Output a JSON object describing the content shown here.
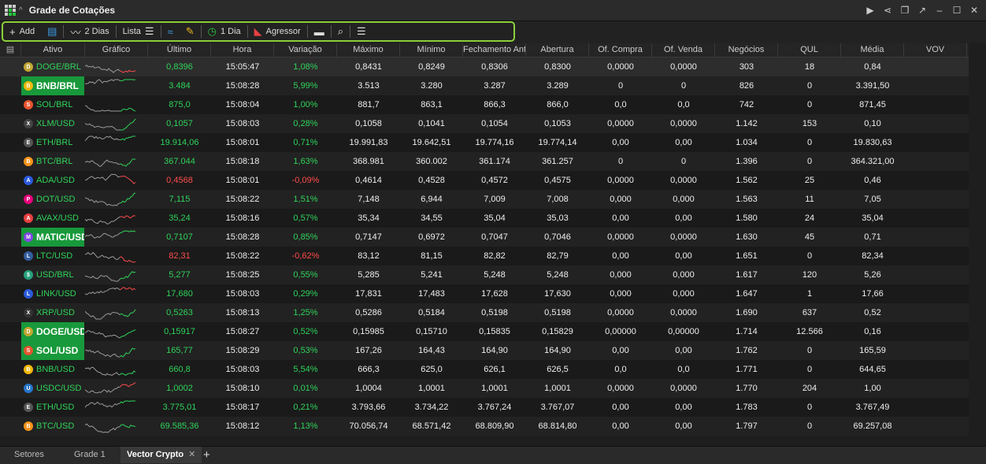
{
  "window": {
    "title": "Grade de Cotações"
  },
  "toolbar": {
    "add": "Add",
    "period": "2 Dias",
    "lista": "Lista",
    "interval": "1 Dia",
    "agressor": "Agressor"
  },
  "columns": [
    "Ativo",
    "Gráfico",
    "Último",
    "Hora",
    "Variação",
    "Máximo",
    "Mínimo",
    "Fechamento Ant",
    "Abertura",
    "Of. Compra",
    "Of. Venda",
    "Negócios",
    "QUL",
    "Média",
    "VOV"
  ],
  "rows": [
    {
      "ativo": "DOGE/BRL",
      "coin": "D",
      "coin_color": "#c2a633",
      "highlight": false,
      "trend": "mixed",
      "ultimo": "0,8396",
      "hora": "15:05:47",
      "variacao": "1,08%",
      "var_sign": "up",
      "maximo": "0,8431",
      "minimo": "0,8249",
      "fechamento": "0,8306",
      "abertura": "0,8300",
      "of_compra": "0,0000",
      "of_venda": "0,0000",
      "negocios": "303",
      "qul": "18",
      "media": "0,84",
      "vov": ""
    },
    {
      "ativo": "BNB/BRL",
      "coin": "B",
      "coin_color": "#f0b90b",
      "highlight": true,
      "trend": "up",
      "ultimo": "3.484",
      "hora": "15:08:28",
      "variacao": "5,99%",
      "var_sign": "up",
      "maximo": "3.513",
      "minimo": "3.280",
      "fechamento": "3.287",
      "abertura": "3.289",
      "of_compra": "0",
      "of_venda": "0",
      "negocios": "826",
      "qul": "0",
      "media": "3.391,50",
      "vov": ""
    },
    {
      "ativo": "SOL/BRL",
      "coin": "S",
      "coin_color": "#e8542f",
      "highlight": false,
      "trend": "up",
      "ultimo": "875,0",
      "hora": "15:08:04",
      "variacao": "1,00%",
      "var_sign": "up",
      "maximo": "881,7",
      "minimo": "863,1",
      "fechamento": "866,3",
      "abertura": "866,0",
      "of_compra": "0,0",
      "of_venda": "0,0",
      "negocios": "742",
      "qul": "0",
      "media": "871,45",
      "vov": ""
    },
    {
      "ativo": "XLM/USD",
      "coin": "X",
      "coin_color": "#444444",
      "highlight": false,
      "trend": "up",
      "ultimo": "0,1057",
      "hora": "15:08:03",
      "variacao": "0,28%",
      "var_sign": "up",
      "maximo": "0,1058",
      "minimo": "0,1041",
      "fechamento": "0,1054",
      "abertura": "0,1053",
      "of_compra": "0,0000",
      "of_venda": "0,0000",
      "negocios": "1.142",
      "qul": "153",
      "media": "0,10",
      "vov": ""
    },
    {
      "ativo": "ETH/BRL",
      "coin": "E",
      "coin_color": "#555555",
      "highlight": false,
      "trend": "up",
      "ultimo": "19.914,06",
      "hora": "15:08:01",
      "variacao": "0,71%",
      "var_sign": "up",
      "maximo": "19.991,83",
      "minimo": "19.642,51",
      "fechamento": "19.774,16",
      "abertura": "19.774,14",
      "of_compra": "0,00",
      "of_venda": "0,00",
      "negocios": "1.034",
      "qul": "0",
      "media": "19.830,63",
      "vov": ""
    },
    {
      "ativo": "BTC/BRL",
      "coin": "B",
      "coin_color": "#f7931a",
      "highlight": false,
      "trend": "up",
      "ultimo": "367.044",
      "hora": "15:08:18",
      "variacao": "1,63%",
      "var_sign": "up",
      "maximo": "368.981",
      "minimo": "360.002",
      "fechamento": "361.174",
      "abertura": "361.257",
      "of_compra": "0",
      "of_venda": "0",
      "negocios": "1.396",
      "qul": "0",
      "media": "364.321,00",
      "vov": ""
    },
    {
      "ativo": "ADA/USD",
      "coin": "A",
      "coin_color": "#2a5ada",
      "highlight": false,
      "trend": "down",
      "ultimo": "0,4568",
      "hora": "15:08:01",
      "variacao": "-0,09%",
      "var_sign": "down",
      "maximo": "0,4614",
      "minimo": "0,4528",
      "fechamento": "0,4572",
      "abertura": "0,4575",
      "of_compra": "0,0000",
      "of_venda": "0,0000",
      "negocios": "1.562",
      "qul": "25",
      "media": "0,46",
      "vov": ""
    },
    {
      "ativo": "DOT/USD",
      "coin": "P",
      "coin_color": "#e6007a",
      "highlight": false,
      "trend": "up",
      "ultimo": "7,115",
      "hora": "15:08:22",
      "variacao": "1,51%",
      "var_sign": "up",
      "maximo": "7,148",
      "minimo": "6,944",
      "fechamento": "7,009",
      "abertura": "7,008",
      "of_compra": "0,000",
      "of_venda": "0,000",
      "negocios": "1.563",
      "qul": "11",
      "media": "7,05",
      "vov": ""
    },
    {
      "ativo": "AVAX/USD",
      "coin": "A",
      "coin_color": "#e84142",
      "highlight": false,
      "trend": "mixed",
      "ultimo": "35,24",
      "hora": "15:08:16",
      "variacao": "0,57%",
      "var_sign": "up",
      "maximo": "35,34",
      "minimo": "34,55",
      "fechamento": "35,04",
      "abertura": "35,03",
      "of_compra": "0,00",
      "of_venda": "0,00",
      "negocios": "1.580",
      "qul": "24",
      "media": "35,04",
      "vov": ""
    },
    {
      "ativo": "MATIC/USD",
      "coin": "M",
      "coin_color": "#8247e5",
      "highlight": true,
      "trend": "up",
      "ultimo": "0,7107",
      "hora": "15:08:28",
      "variacao": "0,85%",
      "var_sign": "up",
      "maximo": "0,7147",
      "minimo": "0,6972",
      "fechamento": "0,7047",
      "abertura": "0,7046",
      "of_compra": "0,0000",
      "of_venda": "0,0000",
      "negocios": "1.630",
      "qul": "45",
      "media": "0,71",
      "vov": ""
    },
    {
      "ativo": "LTC/USD",
      "coin": "L",
      "coin_color": "#345d9d",
      "highlight": false,
      "trend": "down",
      "ultimo": "82,31",
      "hora": "15:08:22",
      "variacao": "-0,62%",
      "var_sign": "down",
      "maximo": "83,12",
      "minimo": "81,15",
      "fechamento": "82,82",
      "abertura": "82,79",
      "of_compra": "0,00",
      "of_venda": "0,00",
      "negocios": "1.651",
      "qul": "0",
      "media": "82,34",
      "vov": ""
    },
    {
      "ativo": "USD/BRL",
      "coin": "$",
      "coin_color": "#26a17b",
      "highlight": false,
      "trend": "up",
      "ultimo": "5,277",
      "hora": "15:08:25",
      "variacao": "0,55%",
      "var_sign": "up",
      "maximo": "5,285",
      "minimo": "5,241",
      "fechamento": "5,248",
      "abertura": "5,248",
      "of_compra": "0,000",
      "of_venda": "0,000",
      "negocios": "1.617",
      "qul": "120",
      "media": "5,26",
      "vov": ""
    },
    {
      "ativo": "LINK/USD",
      "coin": "L",
      "coin_color": "#2a5ada",
      "highlight": false,
      "trend": "mixed",
      "ultimo": "17,680",
      "hora": "15:08:03",
      "variacao": "0,29%",
      "var_sign": "up",
      "maximo": "17,831",
      "minimo": "17,483",
      "fechamento": "17,628",
      "abertura": "17,630",
      "of_compra": "0,000",
      "of_venda": "0,000",
      "negocios": "1.647",
      "qul": "1",
      "media": "17,66",
      "vov": ""
    },
    {
      "ativo": "XRP/USD",
      "coin": "X",
      "coin_color": "#333333",
      "highlight": false,
      "trend": "up",
      "ultimo": "0,5263",
      "hora": "15:08:13",
      "variacao": "1,25%",
      "var_sign": "up",
      "maximo": "0,5286",
      "minimo": "0,5184",
      "fechamento": "0,5198",
      "abertura": "0,5198",
      "of_compra": "0,0000",
      "of_venda": "0,0000",
      "negocios": "1.690",
      "qul": "637",
      "media": "0,52",
      "vov": ""
    },
    {
      "ativo": "DOGE/USD",
      "coin": "D",
      "coin_color": "#c2a633",
      "highlight": true,
      "trend": "up",
      "ultimo": "0,15917",
      "hora": "15:08:27",
      "variacao": "0,52%",
      "var_sign": "up",
      "maximo": "0,15985",
      "minimo": "0,15710",
      "fechamento": "0,15835",
      "abertura": "0,15829",
      "of_compra": "0,00000",
      "of_venda": "0,00000",
      "negocios": "1.714",
      "qul": "12.566",
      "media": "0,16",
      "vov": ""
    },
    {
      "ativo": "SOL/USD",
      "coin": "S",
      "coin_color": "#e8542f",
      "highlight": true,
      "trend": "up",
      "ultimo": "165,77",
      "hora": "15:08:29",
      "variacao": "0,53%",
      "var_sign": "up",
      "maximo": "167,26",
      "minimo": "164,43",
      "fechamento": "164,90",
      "abertura": "164,90",
      "of_compra": "0,00",
      "of_venda": "0,00",
      "negocios": "1.762",
      "qul": "0",
      "media": "165,59",
      "vov": ""
    },
    {
      "ativo": "BNB/USD",
      "coin": "B",
      "coin_color": "#f0b90b",
      "highlight": false,
      "trend": "up",
      "ultimo": "660,8",
      "hora": "15:08:03",
      "variacao": "5,54%",
      "var_sign": "up",
      "maximo": "666,3",
      "minimo": "625,0",
      "fechamento": "626,1",
      "abertura": "626,5",
      "of_compra": "0,0",
      "of_venda": "0,0",
      "negocios": "1.771",
      "qul": "0",
      "media": "644,65",
      "vov": ""
    },
    {
      "ativo": "USDC/USD",
      "coin": "U",
      "coin_color": "#2775ca",
      "highlight": false,
      "trend": "mixed",
      "ultimo": "1,0002",
      "hora": "15:08:10",
      "variacao": "0,01%",
      "var_sign": "up",
      "maximo": "1,0004",
      "minimo": "1,0001",
      "fechamento": "1,0001",
      "abertura": "1,0001",
      "of_compra": "0,0000",
      "of_venda": "0,0000",
      "negocios": "1.770",
      "qul": "204",
      "media": "1,00",
      "vov": ""
    },
    {
      "ativo": "ETH/USD",
      "coin": "E",
      "coin_color": "#555555",
      "highlight": false,
      "trend": "up",
      "ultimo": "3.775,01",
      "hora": "15:08:17",
      "variacao": "0,21%",
      "var_sign": "up",
      "maximo": "3.793,66",
      "minimo": "3.734,22",
      "fechamento": "3.767,24",
      "abertura": "3.767,07",
      "of_compra": "0,00",
      "of_venda": "0,00",
      "negocios": "1.783",
      "qul": "0",
      "media": "3.767,49",
      "vov": ""
    },
    {
      "ativo": "BTC/USD",
      "coin": "B",
      "coin_color": "#f7931a",
      "highlight": false,
      "trend": "up",
      "ultimo": "69.585,36",
      "hora": "15:08:12",
      "variacao": "1,13%",
      "var_sign": "up",
      "maximo": "70.056,74",
      "minimo": "68.571,42",
      "fechamento": "68.809,90",
      "abertura": "68.814,80",
      "of_compra": "0,00",
      "of_venda": "0,00",
      "negocios": "1.797",
      "qul": "0",
      "media": "69.257,08",
      "vov": ""
    }
  ],
  "tabs": [
    {
      "label": "Setores",
      "active": false
    },
    {
      "label": "Grade 1",
      "active": false
    },
    {
      "label": "Vector Crypto",
      "active": true
    }
  ],
  "colors": {
    "up": "#2fd35a",
    "down": "#ff4b4b",
    "highlight": "#18993b",
    "toolbar_border": "#8ccf3a"
  }
}
